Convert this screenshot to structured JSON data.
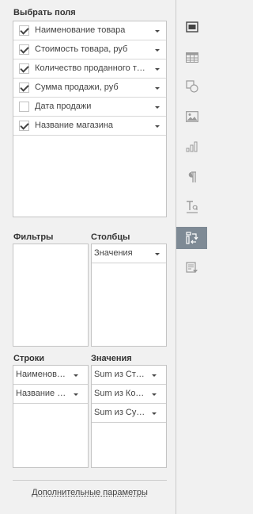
{
  "sections": {
    "select_fields": "Выбрать поля",
    "filters": "Фильтры",
    "columns": "Столбцы",
    "rows": "Строки",
    "values": "Значения"
  },
  "fields": [
    {
      "label": "Наименование товара",
      "checked": true
    },
    {
      "label": "Стоимость товара, руб",
      "checked": true
    },
    {
      "label": "Количество проданного товара",
      "checked": true
    },
    {
      "label": "Сумма продажи, руб",
      "checked": true
    },
    {
      "label": "Дата продажи",
      "checked": false
    },
    {
      "label": "Название магазина",
      "checked": true
    }
  ],
  "columns_items": [
    {
      "label": "Значения"
    }
  ],
  "rows_items": [
    {
      "label": "Наименование товара"
    },
    {
      "label": "Название магазина"
    }
  ],
  "values_items": [
    {
      "label": "Sum из Стоимость товара, руб"
    },
    {
      "label": "Sum из Количество проданного товара"
    },
    {
      "label": "Sum из Сумма продажи, руб"
    }
  ],
  "advanced_link": "Дополнительные параметры",
  "toolbar": {
    "icons": [
      "slide-settings-icon",
      "table-settings-icon",
      "shape-settings-icon",
      "image-settings-icon",
      "chart-settings-icon",
      "paragraph-settings-icon",
      "text-art-icon",
      "pivot-table-settings-icon",
      "form-settings-icon"
    ],
    "active": "pivot-table-settings-icon",
    "active_color": "#7e8a95"
  }
}
